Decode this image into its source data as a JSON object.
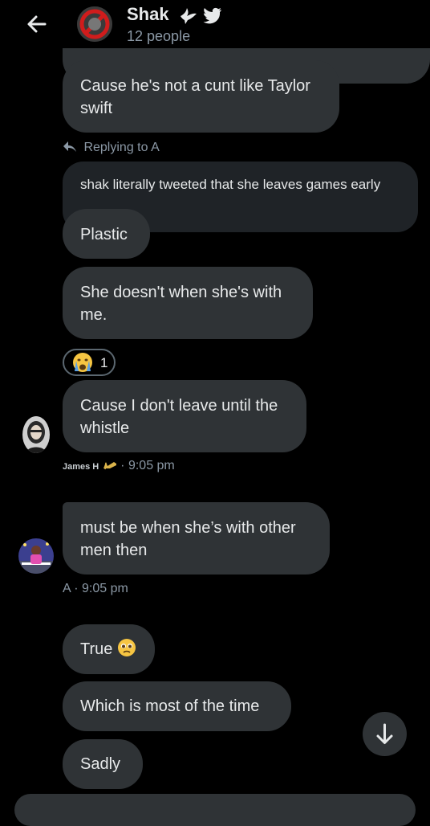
{
  "header": {
    "title": "Shak",
    "subtitle": "12 people",
    "icons": [
      "back-arrow-icon",
      "no-sign-avatar",
      "dove-icon",
      "twitter-bird-icon"
    ]
  },
  "messages": {
    "m1": "Cause he's not a cunt like Taylor swift",
    "reply_label": "Replying to A",
    "quoted": "shak literally tweeted that she leaves games early",
    "m2": "Plastic",
    "m3": "She doesn't when she's with me.",
    "reaction_count": "1",
    "reaction_emoji": "crying-face",
    "m4": "Cause I don't leave until the whistle",
    "m4_sender": "James H",
    "m4_time": "· 9:05 pm",
    "m5": "must be when she’s with other men then",
    "m5_meta": "A · 9:05 pm",
    "m6": "True",
    "m6_emoji": "pleading-face",
    "m7": "Which is most of the time",
    "m8": "Sadly"
  },
  "colors": {
    "bubble": "#2f3336",
    "quoted": "#1f2327",
    "meta_text": "#8b98a5",
    "text": "#e7e9ea",
    "background": "#000000"
  }
}
